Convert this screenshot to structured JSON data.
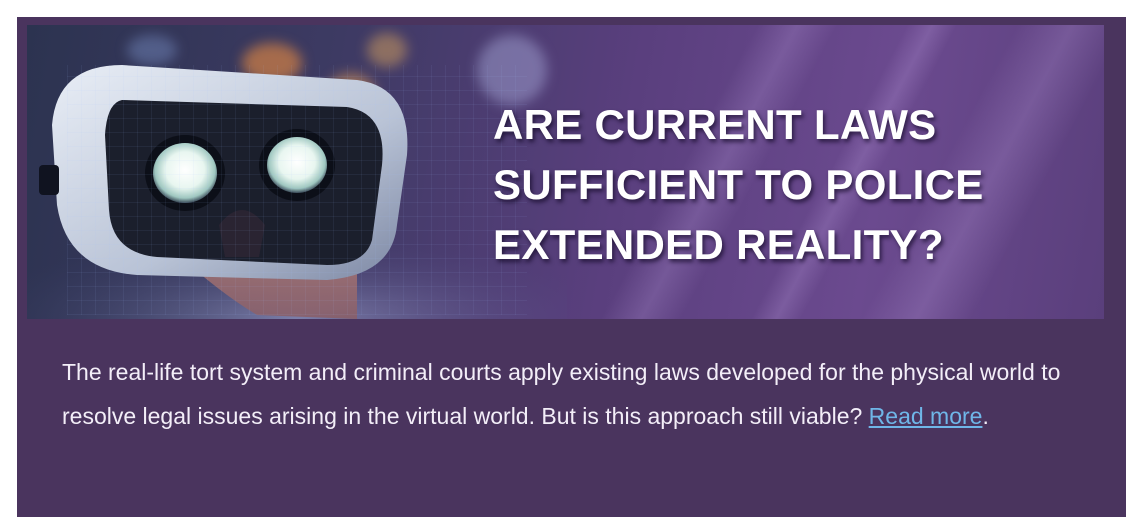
{
  "banner": {
    "headline_lines": [
      "ARE CURRENT LAWS",
      "SUFFICIENT TO POLICE",
      "EXTENDED REALITY?"
    ],
    "image_subject": "person-wearing-vr-headset"
  },
  "article": {
    "summary": "The real-life tort system and criminal courts apply existing laws developed for the physical world to resolve legal issues arising in the virtual world. But is this approach still viable?",
    "link_label": "Read more",
    "trailing_punctuation": "."
  },
  "colors": {
    "card_background": "#4a345e",
    "headline_text": "#ffffff",
    "body_text": "#f3eef8",
    "link": "#6fb6e8"
  }
}
